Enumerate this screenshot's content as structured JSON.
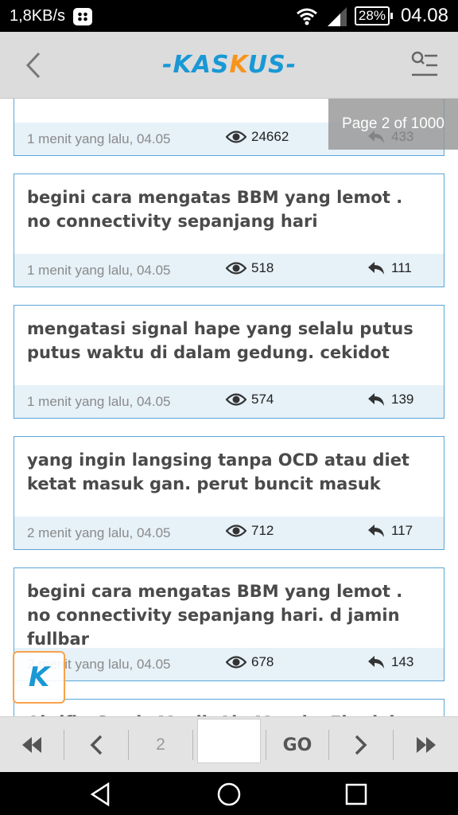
{
  "status_bar": {
    "network_speed": "1,8KB/s",
    "battery": "28%",
    "time": "04.08",
    "icons": [
      "bbm-icon",
      "wifi-icon",
      "signal-icon",
      "battery-icon"
    ]
  },
  "header": {
    "logo_text_1": "-KAS",
    "logo_text_2": "K",
    "logo_text_3": "US-",
    "icons": [
      "back-arrow-icon",
      "search-menu-icon"
    ]
  },
  "page_indicator": "Page 2 of 1000",
  "threads": [
    {
      "title": "",
      "time": "1 menit yang lalu, 04.05",
      "views": "24662",
      "replies": "433"
    },
    {
      "title": "begini cara mengatas BBM yang lemot . no connectivity sepanjang hari",
      "time": "1 menit yang lalu, 04.05",
      "views": "518",
      "replies": "111"
    },
    {
      "title": "mengatasi signal hape yang selalu putus putus waktu di dalam gedung. cekidot",
      "time": "1 menit yang lalu, 04.05",
      "views": "574",
      "replies": "139"
    },
    {
      "title": "yang ingin langsing tanpa OCD atau diet ketat masuk gan. perut buncit masuk",
      "time": "2 menit yang lalu, 04.05",
      "views": "712",
      "replies": "117"
    },
    {
      "title": "begini cara mengatas BBM yang lemot . no connectivity sepanjang hari. d jamin fullbar",
      "time": "2 menit yang lalu, 04.05",
      "views": "678",
      "replies": "143"
    },
    {
      "title": "Aktifin Gratis Musik Aja Mereka Ekreleh",
      "time": "",
      "views": "",
      "replies": ""
    }
  ],
  "fab_label": "K",
  "pager": {
    "current_page": "2",
    "go_label": "GO",
    "page_input_value": "",
    "icons": [
      "first-page-icon",
      "prev-page-icon",
      "next-page-icon",
      "last-page-icon"
    ]
  },
  "nav": {
    "icons": [
      "nav-back-icon",
      "nav-home-icon",
      "nav-recents-icon"
    ]
  },
  "colors": {
    "accent_blue": "#1998d5",
    "accent_orange": "#f7941d",
    "card_border": "#5aa6d6",
    "card_meta_bg": "#e6f1f8",
    "header_bg": "#dcdcdc"
  }
}
